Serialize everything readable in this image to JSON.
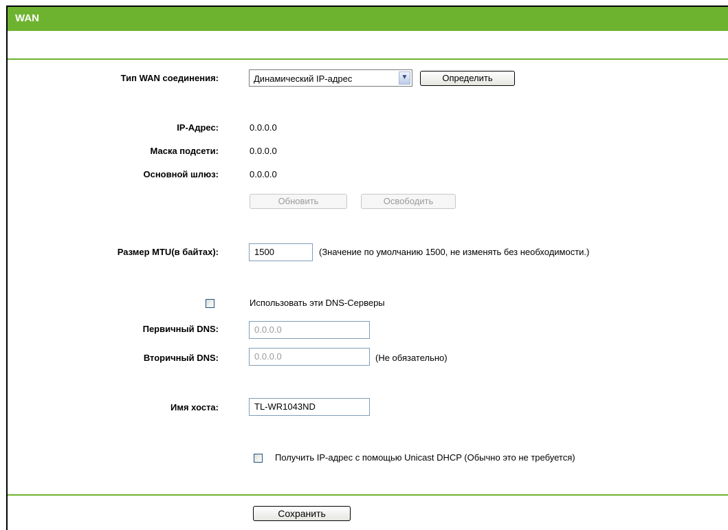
{
  "header": {
    "title": "WAN"
  },
  "wan_type": {
    "label": "Тип WAN соединения:",
    "selected": "Динамический IP-адрес",
    "detect_button": "Определить"
  },
  "status": {
    "ip_label": "IP-Адрес:",
    "ip_value": "0.0.0.0",
    "mask_label": "Маска подсети:",
    "mask_value": "0.0.0.0",
    "gateway_label": "Основной шлюз:",
    "gateway_value": "0.0.0.0",
    "renew_button": "Обновить",
    "release_button": "Освободить"
  },
  "mtu": {
    "label": "Размер MTU(в байтах):",
    "value": "1500",
    "hint": "(Значение по умолчанию 1500, не изменять без необходимости.)"
  },
  "dns": {
    "use_label": "Использовать эти DNS-Серверы",
    "primary_label": "Первичный DNS:",
    "primary_value": "0.0.0.0",
    "secondary_label": "Вторичный DNS:",
    "secondary_value": "0.0.0.0",
    "secondary_hint": "(Не обязательно)"
  },
  "host": {
    "label": "Имя хоста:",
    "value": "TL-WR1043ND"
  },
  "unicast": {
    "label": "Получить IP-адрес с помощью Unicast DHCP (Обычно это не требуется)"
  },
  "footer": {
    "save_button": "Сохранить"
  },
  "colors": {
    "accent": "#6eb32f",
    "select_arrow": "#2d4b86"
  },
  "icons": {
    "select_arrow": "chevron-down-icon"
  }
}
